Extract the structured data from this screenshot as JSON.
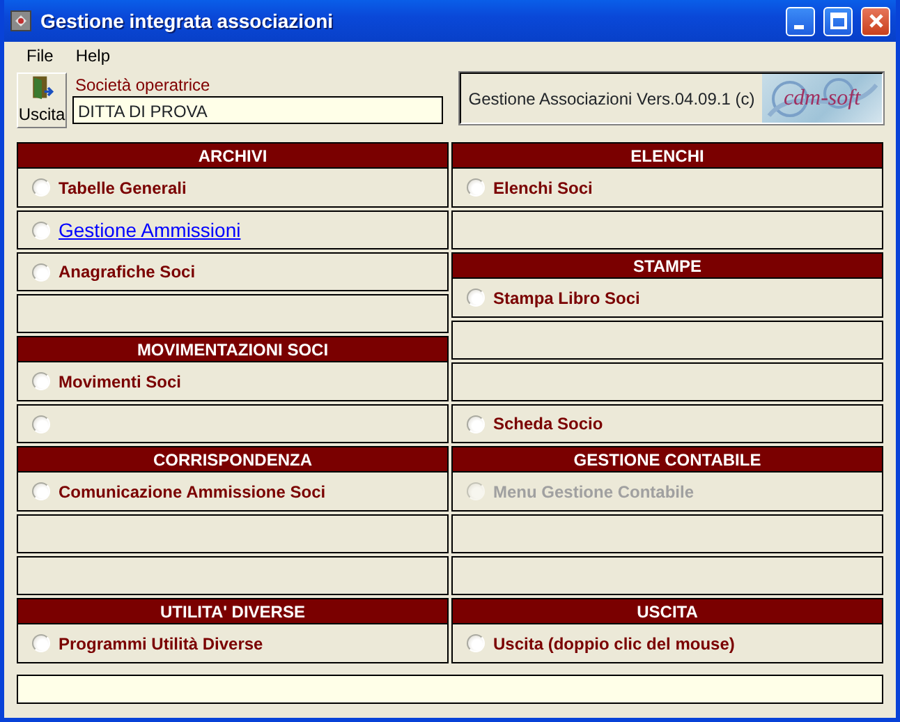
{
  "window": {
    "title": "Gestione integrata associazioni"
  },
  "menu": [
    {
      "label": "File"
    },
    {
      "label": "Help"
    }
  ],
  "toolbar": {
    "exit_button": "Uscita",
    "company_label": "Società operatrice",
    "company_value": "DITTA DI PROVA",
    "version": "Gestione Associazioni Vers.04.09.1 (c)",
    "logo_text": "cdm-soft"
  },
  "columns": [
    [
      {
        "kind": "header",
        "label": "ARCHIVI"
      },
      {
        "kind": "item",
        "label": "Tabelle Generali",
        "selected": false,
        "disabled": false
      },
      {
        "kind": "link",
        "label": "Gestione Ammissioni",
        "selected": false,
        "disabled": false
      },
      {
        "kind": "item",
        "label": "Anagrafiche Soci",
        "selected": false,
        "disabled": false
      },
      {
        "kind": "blank"
      },
      {
        "kind": "header",
        "label": "MOVIMENTAZIONI SOCI"
      },
      {
        "kind": "item",
        "label": "Movimenti Soci",
        "selected": false,
        "disabled": false
      },
      {
        "kind": "item",
        "selected": false,
        "disabled": false
      },
      {
        "kind": "header",
        "label": "CORRISPONDENZA"
      },
      {
        "kind": "item",
        "label": "Comunicazione Ammissione Soci",
        "selected": false,
        "disabled": false
      },
      {
        "kind": "blank"
      },
      {
        "kind": "blank"
      },
      {
        "kind": "header",
        "label": "UTILITA' DIVERSE"
      },
      {
        "kind": "item",
        "label": "Programmi Utilità Diverse",
        "selected": false,
        "disabled": false
      }
    ],
    [
      {
        "kind": "header",
        "label": "ELENCHI"
      },
      {
        "kind": "item",
        "label": "Elenchi Soci",
        "selected": false,
        "disabled": false
      },
      {
        "kind": "blank"
      },
      {
        "kind": "header",
        "label": "STAMPE"
      },
      {
        "kind": "item",
        "label": "Stampa Libro Soci",
        "selected": false,
        "disabled": false
      },
      {
        "kind": "blank"
      },
      {
        "kind": "blank"
      },
      {
        "kind": "item",
        "label": "Scheda Socio",
        "selected": false,
        "disabled": false
      },
      {
        "kind": "header",
        "label": "GESTIONE CONTABILE"
      },
      {
        "kind": "item",
        "label": "Menu Gestione Contabile",
        "selected": false,
        "disabled": true
      },
      {
        "kind": "blank"
      },
      {
        "kind": "blank"
      },
      {
        "kind": "header",
        "label": "USCITA"
      },
      {
        "kind": "item",
        "label": "Uscita (doppio clic del mouse)",
        "selected": false,
        "disabled": false
      }
    ]
  ]
}
